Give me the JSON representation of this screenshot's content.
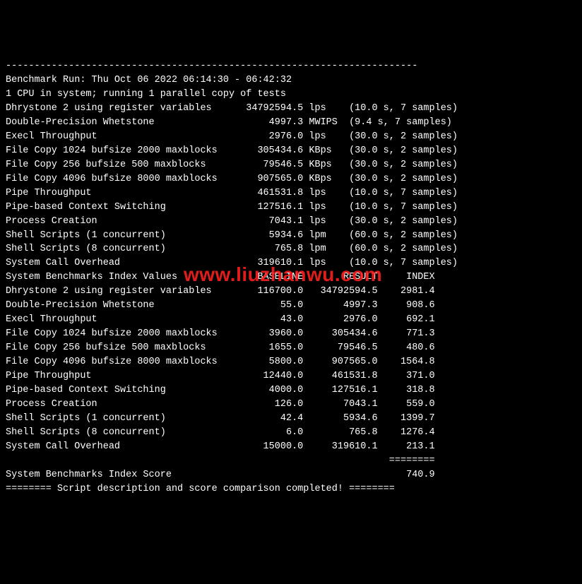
{
  "header": {
    "divider_top": "------------------------------------------------------------------------",
    "run_line": "Benchmark Run: Thu Oct 06 2022 06:14:30 - 06:42:32",
    "cpu_line": "1 CPU in system; running 1 parallel copy of tests"
  },
  "watermark": "www.liuzhanwu.com",
  "tests": [
    {
      "label": "Dhrystone 2 using register variables",
      "value": "34792594.5",
      "unit": "lps",
      "timing": "(10.0 s, 7 samples)"
    },
    {
      "label": "Double-Precision Whetstone",
      "value": "4997.3",
      "unit": "MWIPS",
      "timing": "(9.4 s, 7 samples)"
    },
    {
      "label": "Execl Throughput",
      "value": "2976.0",
      "unit": "lps",
      "timing": "(30.0 s, 2 samples)"
    },
    {
      "label": "File Copy 1024 bufsize 2000 maxblocks",
      "value": "305434.6",
      "unit": "KBps",
      "timing": "(30.0 s, 2 samples)"
    },
    {
      "label": "File Copy 256 bufsize 500 maxblocks",
      "value": "79546.5",
      "unit": "KBps",
      "timing": "(30.0 s, 2 samples)"
    },
    {
      "label": "File Copy 4096 bufsize 8000 maxblocks",
      "value": "907565.0",
      "unit": "KBps",
      "timing": "(30.0 s, 2 samples)"
    },
    {
      "label": "Pipe Throughput",
      "value": "461531.8",
      "unit": "lps",
      "timing": "(10.0 s, 7 samples)"
    },
    {
      "label": "Pipe-based Context Switching",
      "value": "127516.1",
      "unit": "lps",
      "timing": "(10.0 s, 7 samples)"
    },
    {
      "label": "Process Creation",
      "value": "7043.1",
      "unit": "lps",
      "timing": "(30.0 s, 2 samples)"
    },
    {
      "label": "Shell Scripts (1 concurrent)",
      "value": "5934.6",
      "unit": "lpm",
      "timing": "(60.0 s, 2 samples)"
    },
    {
      "label": "Shell Scripts (8 concurrent)",
      "value": "765.8",
      "unit": "lpm",
      "timing": "(60.0 s, 2 samples)"
    },
    {
      "label": "System Call Overhead",
      "value": "319610.1",
      "unit": "lps",
      "timing": "(10.0 s, 7 samples)"
    }
  ],
  "index_header": {
    "title": "System Benchmarks Index Values",
    "col_baseline": "BASELINE",
    "col_result": "RESULT",
    "col_index": "INDEX"
  },
  "index_rows": [
    {
      "label": "Dhrystone 2 using register variables",
      "baseline": "116700.0",
      "result": "34792594.5",
      "index": "2981.4"
    },
    {
      "label": "Double-Precision Whetstone",
      "baseline": "55.0",
      "result": "4997.3",
      "index": "908.6"
    },
    {
      "label": "Execl Throughput",
      "baseline": "43.0",
      "result": "2976.0",
      "index": "692.1"
    },
    {
      "label": "File Copy 1024 bufsize 2000 maxblocks",
      "baseline": "3960.0",
      "result": "305434.6",
      "index": "771.3"
    },
    {
      "label": "File Copy 256 bufsize 500 maxblocks",
      "baseline": "1655.0",
      "result": "79546.5",
      "index": "480.6"
    },
    {
      "label": "File Copy 4096 bufsize 8000 maxblocks",
      "baseline": "5800.0",
      "result": "907565.0",
      "index": "1564.8"
    },
    {
      "label": "Pipe Throughput",
      "baseline": "12440.0",
      "result": "461531.8",
      "index": "371.0"
    },
    {
      "label": "Pipe-based Context Switching",
      "baseline": "4000.0",
      "result": "127516.1",
      "index": "318.8"
    },
    {
      "label": "Process Creation",
      "baseline": "126.0",
      "result": "7043.1",
      "index": "559.0"
    },
    {
      "label": "Shell Scripts (1 concurrent)",
      "baseline": "42.4",
      "result": "5934.6",
      "index": "1399.7"
    },
    {
      "label": "Shell Scripts (8 concurrent)",
      "baseline": "6.0",
      "result": "765.8",
      "index": "1276.4"
    },
    {
      "label": "System Call Overhead",
      "baseline": "15000.0",
      "result": "319610.1",
      "index": "213.1"
    }
  ],
  "score": {
    "divider": "                                                                   ========",
    "label": "System Benchmarks Index Score",
    "value": "740.9"
  },
  "footer": {
    "line": "======== Script description and score comparison completed! ========"
  }
}
